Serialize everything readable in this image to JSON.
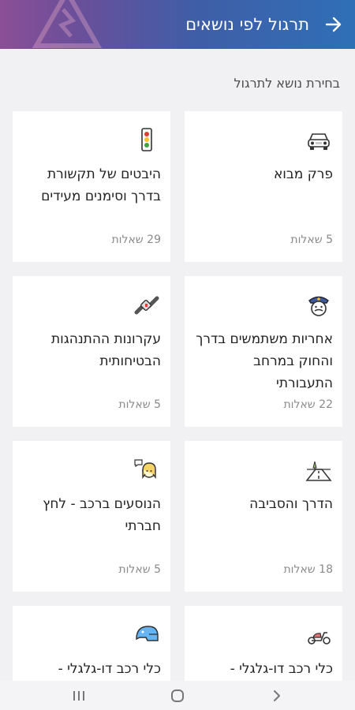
{
  "header": {
    "title": "תרגול לפי נושאים",
    "back_icon": "arrow-right-icon"
  },
  "section_label": "בחירת נושא לתרגול",
  "cards": [
    {
      "title": "פרק מבוא",
      "count": "5 שאלות",
      "icon": "car-icon"
    },
    {
      "title": "היבטים של תקשורת בדרך וסימנים מעידים",
      "count": "29 שאלות",
      "icon": "traffic-light-icon"
    },
    {
      "title": "אחריות משתמשים בדרך והחוק במרחב התעבורתי",
      "count": "22 שאלות",
      "icon": "police-officer-icon"
    },
    {
      "title": "עקרונות ההתנהגות הבטיחותית",
      "count": "5 שאלות",
      "icon": "seatbelt-icon"
    },
    {
      "title": "הדרך והסביבה",
      "count": "18 שאלות",
      "icon": "road-icon"
    },
    {
      "title": "הנוסעים ברכב - לחץ חברתי",
      "count": "5 שאלות",
      "icon": "passenger-talking-icon"
    },
    {
      "title": "כלי רכב דו-גלגלי -",
      "count": "",
      "icon": "scooter-icon"
    },
    {
      "title": "כלי רכב דו-גלגלי -",
      "count": "",
      "icon": "helmet-icon"
    }
  ],
  "system_nav": {
    "recent_icon": "recent-apps-icon",
    "home_icon": "home-icon",
    "back_icon": "back-chevron-icon"
  }
}
